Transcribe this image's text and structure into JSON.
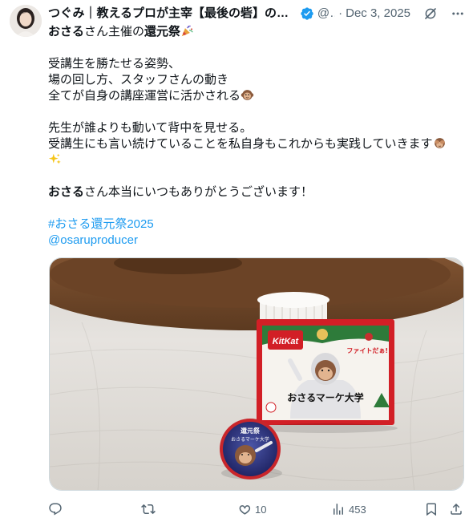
{
  "tweet": {
    "author_name": "つぐみ｜教えるプロが主宰【最後の砦】の起業家",
    "handle": "@..",
    "separator": "·",
    "date": "Dec 3, 2025",
    "body": {
      "line1_bold": "おさる",
      "line1_rest": "さん主催の",
      "line1_bold2": "還元祭",
      "line2": "受講生を勝たせる姿勢、",
      "line3": "場の回し方、スタッフさんの動き",
      "line4": "全てが自身の講座運営に活かされる",
      "line5": "先生が誰よりも動いて背中を見せる。",
      "line6": "受講生にも言い続けていることを私自身もこれからも実践していきます",
      "line8_bold": "おさる",
      "line8_rest": "さん本当にいつもありがとうございます！",
      "hashtag": "#おさる還元祭2025",
      "mention": "@osaruproducer"
    },
    "media": {
      "box_brand": "KitKat",
      "box_caption": "おさるマーケ大学",
      "box_banner": "ファイトだぁ!!",
      "badge_line1": "還元祭",
      "badge_line2": "おさるマーケ大学"
    },
    "actions": {
      "reply_count": "",
      "retweet_count": "",
      "like_count": "10",
      "views_count": "453"
    }
  },
  "colors": {
    "text": "#0f1419",
    "secondary": "#536471",
    "link": "#1d9bf0",
    "verified": "#1d9bf0"
  },
  "icons": [
    "avatar",
    "verified-badge-icon",
    "grok-icon",
    "more-icon",
    "party-popper-emoji",
    "monkey-face-emoji",
    "see-no-evil-monkey-emoji",
    "sparkles-emoji",
    "reply-icon",
    "retweet-icon",
    "like-icon",
    "views-icon",
    "bookmark-icon",
    "share-icon"
  ]
}
